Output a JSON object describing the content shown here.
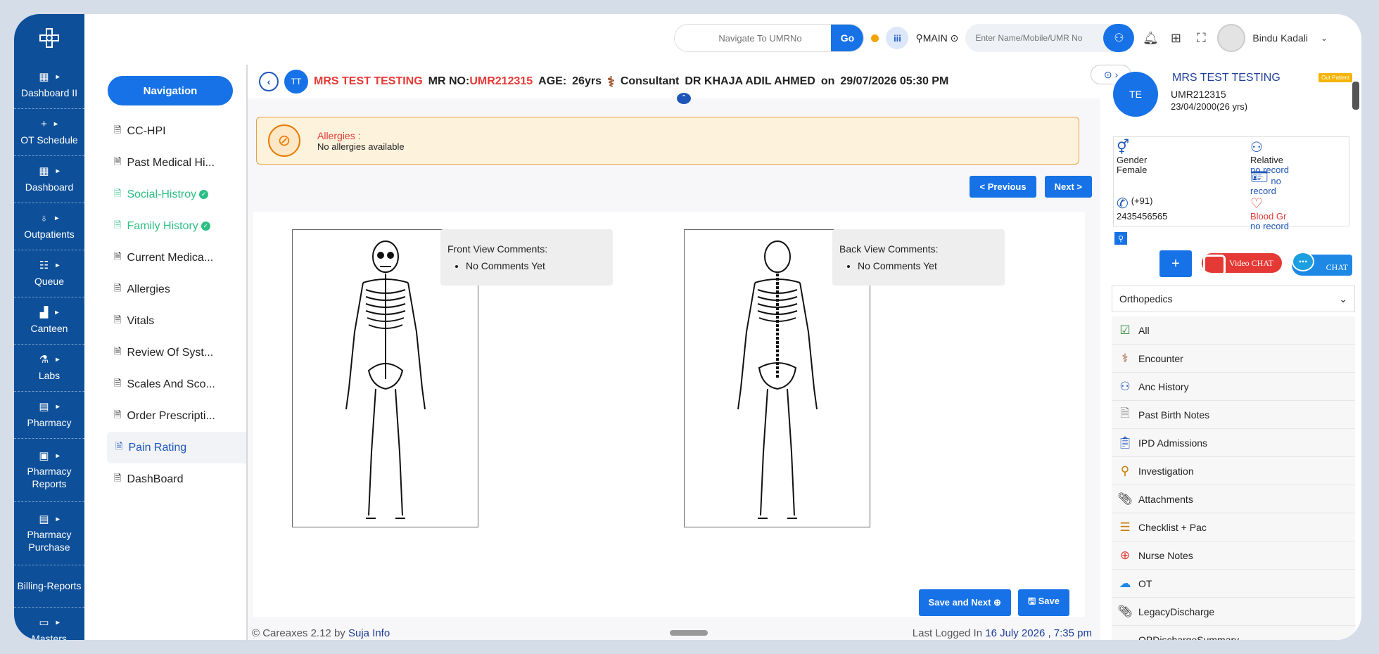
{
  "sidebar": {
    "items": [
      {
        "label": "Dashboard II",
        "icon": "grid-icon"
      },
      {
        "label": "OT Schedule",
        "icon": "plus-icon"
      },
      {
        "label": "Dashboard",
        "icon": "dashboard-icon"
      },
      {
        "label": "Outpatients",
        "icon": "stethoscope-icon"
      },
      {
        "label": "Queue",
        "icon": "queue-icon"
      },
      {
        "label": "Canteen",
        "icon": "canteen-icon"
      },
      {
        "label": "Labs",
        "icon": "flask-icon"
      },
      {
        "label": "Pharmacy",
        "icon": "store-icon"
      },
      {
        "label": "Pharmacy Reports",
        "icon": "report-icon"
      },
      {
        "label": "Pharmacy Purchase",
        "icon": "purchase-icon"
      },
      {
        "label": "Billing-Reports",
        "icon": "billing-icon"
      },
      {
        "label": "Masters",
        "icon": "masters-icon"
      }
    ]
  },
  "topbar": {
    "nav_placeholder": "Navigate To UMRNo",
    "go_label": "Go",
    "location": "MAIN",
    "search_placeholder": "Enter Name/Mobile/UMR No",
    "user_name": "Bindu Kadali"
  },
  "nav": {
    "title": "Navigation",
    "items": [
      {
        "label": "CC-HPI"
      },
      {
        "label": "Past Medical Hi..."
      },
      {
        "label": "Social-Histroy"
      },
      {
        "label": "Family History"
      },
      {
        "label": "Current Medica..."
      },
      {
        "label": "Allergies"
      },
      {
        "label": "Vitals"
      },
      {
        "label": "Review Of Syst..."
      },
      {
        "label": "Scales And Sco..."
      },
      {
        "label": "Order Prescripti..."
      },
      {
        "label": "Pain Rating"
      },
      {
        "label": "DashBoard"
      }
    ]
  },
  "patient_bar": {
    "initials": "TT",
    "name": "MRS TEST TESTING",
    "mr_label": "MR NO:",
    "mr_no": "UMR212315",
    "age_label": "AGE:",
    "age": "26yrs",
    "consultant_label": "Consultant",
    "consultant": "DR KHAJA ADIL AHMED",
    "on_label": "on",
    "datetime": "29/07/2026 05:30 PM"
  },
  "allergy": {
    "title": "Allergies :",
    "value": "No allergies available"
  },
  "buttons": {
    "previous": "< Previous",
    "next": "Next >",
    "save_next": "Save and Next ⊕",
    "save": "🖫 Save"
  },
  "front": {
    "title": "Front View Comments:",
    "comment": "No Comments Yet"
  },
  "back": {
    "title": "Back View Comments:",
    "comment": "No Comments Yet"
  },
  "footer": {
    "copyright": "© Careaxes 2.12 by",
    "company": "Suja Info",
    "last_label": "Last Logged In",
    "last_value": "16 July 2026 , 7:35 pm"
  },
  "right_panel": {
    "initials": "TE",
    "name": "MRS TEST TESTING",
    "badge": "Out Patient",
    "umr": "UMR212315",
    "dob": "23/04/2000(26 yrs)",
    "gender_label": "Gender",
    "gender": "Female",
    "relative_label": "Relative",
    "relative": "no record",
    "idcard": "no record",
    "phone_code": "(+91)",
    "phone": "2435456565",
    "blood_label": "Blood Gr",
    "blood": "no record",
    "plus": "+",
    "video_chat": "Video CHAT",
    "chat": "CHAT",
    "specialty": "Orthopedics",
    "list": [
      {
        "label": "All",
        "icon": "checklist-icon"
      },
      {
        "label": "Encounter",
        "icon": "caduceus-icon"
      },
      {
        "label": "Anc History",
        "icon": "doctor-icon"
      },
      {
        "label": "Past Birth Notes",
        "icon": "notes-icon"
      },
      {
        "label": "IPD Admissions",
        "icon": "clipboard-icon"
      },
      {
        "label": "Investigation",
        "icon": "investigation-icon"
      },
      {
        "label": "Attachments",
        "icon": "paperclip-icon"
      },
      {
        "label": "Checklist + Pac",
        "icon": "checklist-icon"
      },
      {
        "label": "Nurse Notes",
        "icon": "nurse-icon"
      },
      {
        "label": "OT",
        "icon": "ot-icon"
      },
      {
        "label": "LegacyDischarge",
        "icon": "paperclip-icon"
      },
      {
        "label": "OPDischargeSummary",
        "icon": ""
      }
    ]
  }
}
